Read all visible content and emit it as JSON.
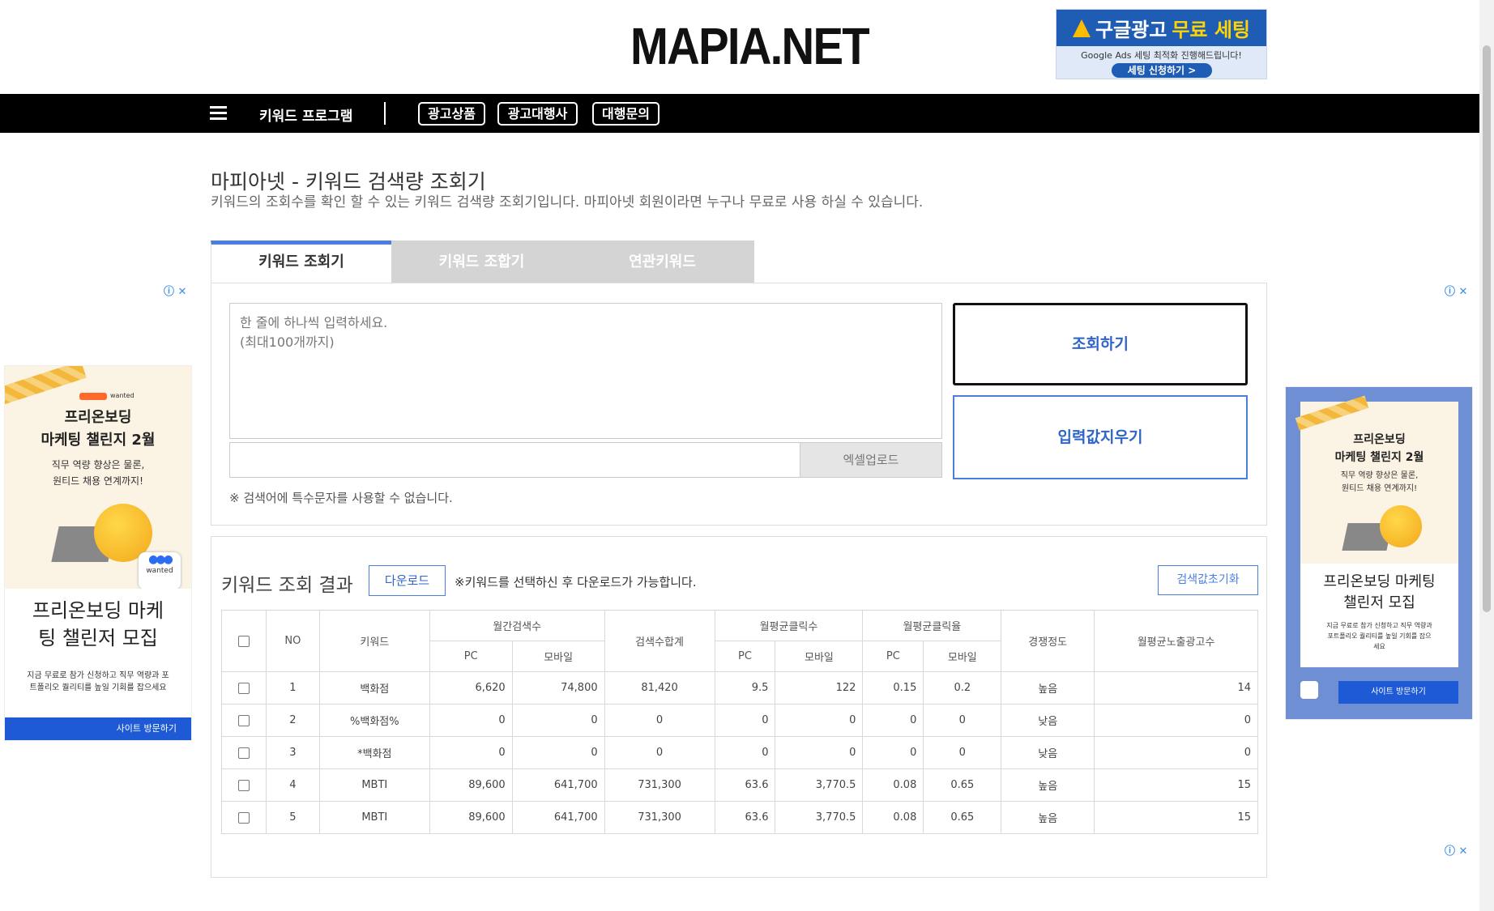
{
  "header": {
    "logo": "MAPIA.NET",
    "top_ad": {
      "headline_a": "구글광고",
      "headline_b": "무료 세팅",
      "subline": "Google Ads 세팅 최적화 진행해드립니다!",
      "cta": "세팅 신청하기 >"
    }
  },
  "nav": {
    "menu_title": "키워드 프로그램",
    "buttons": [
      "광고상품",
      "광고대행사",
      "대행문의"
    ]
  },
  "intro": {
    "title": "마피아넷 - 키워드 검색량 조회기",
    "description": "키워드의 조회수를 확인 할 수 있는 키워드 검색량 조회기입니다. 마피아넷 회원이라면 누구나 무료로 사용 하실 수 있습니다."
  },
  "tabs": [
    "키워드 조회기",
    "키워드 조합기",
    "연관키워드"
  ],
  "input_panel": {
    "textarea_placeholder": "한 줄에 하나씩 입력하세요.\n(최대100개까지)",
    "excel_upload": "엑셀업로드",
    "notice": "※ 검색어에 특수문자를 사용할 수 없습니다.",
    "search_button": "조회하기",
    "clear_button": "입력값지우기"
  },
  "results": {
    "title": "키워드 조회 결과",
    "download_button": "다운로드",
    "note": "※키워드를 선택하신 후 다운로드가 가능합니다.",
    "reset_button": "검색값초기화",
    "headers": {
      "no": "NO",
      "keyword": "키워드",
      "monthly_search": "월간검색수",
      "search_total": "검색수합계",
      "avg_clicks": "월평균클릭수",
      "avg_ctr": "월평균클릭율",
      "competition": "경쟁정도",
      "avg_impressions": "월평균노출광고수",
      "pc": "PC",
      "mobile": "모바일"
    },
    "rows": [
      {
        "no": "1",
        "keyword": "백화점",
        "pc": "6,620",
        "mobile": "74,800",
        "total": "81,420",
        "click_pc": "9.5",
        "click_mobile": "122",
        "ctr_pc": "0.15",
        "ctr_mobile": "0.2",
        "competition": "높음",
        "impressions": "14"
      },
      {
        "no": "2",
        "keyword": "%백화점%",
        "pc": "0",
        "mobile": "0",
        "total": "0",
        "click_pc": "0",
        "click_mobile": "0",
        "ctr_pc": "0",
        "ctr_mobile": "0",
        "competition": "낮음",
        "impressions": "0"
      },
      {
        "no": "3",
        "keyword": "*백화점",
        "pc": "0",
        "mobile": "0",
        "total": "0",
        "click_pc": "0",
        "click_mobile": "0",
        "ctr_pc": "0",
        "ctr_mobile": "0",
        "competition": "낮음",
        "impressions": "0"
      },
      {
        "no": "4",
        "keyword": "MBTI",
        "pc": "89,600",
        "mobile": "641,700",
        "total": "731,300",
        "click_pc": "63.6",
        "click_mobile": "3,770.5",
        "ctr_pc": "0.08",
        "ctr_mobile": "0.65",
        "competition": "높음",
        "impressions": "15"
      },
      {
        "no": "5",
        "keyword": "MBTI",
        "pc": "89,600",
        "mobile": "641,700",
        "total": "731,300",
        "click_pc": "63.6",
        "click_mobile": "3,770.5",
        "ctr_pc": "0.08",
        "ctr_mobile": "0.65",
        "competition": "높음",
        "impressions": "15"
      }
    ]
  },
  "side_ads": {
    "left": {
      "brand": "wanted",
      "title": "프리온보딩\n마케팅 챌린지 2월",
      "sub": "직무 역량 향상은 물론,\n원티드 채용 연계까지!",
      "headline": "프리온보딩 마케\n팅 챌린저 모집",
      "body": "지금 무료로 참가 신청하고 직무 역량과 포\n트폴리오 퀄리티를 높일 기회를 잡으세요",
      "cta": "사이트 방문하기"
    },
    "right": {
      "title": "프리온보딩\n마케팅 챌린지 2월",
      "sub": "직무 역량 향상은 물론,\n원티드 채용 연계까지!",
      "headline": "프리온보딩 마케팅\n챌린저 모집",
      "body": "지금 무료로 참가 신청하고 직무 역량과\n포트폴리오 퀄리티를 높일 기회를 잡으\n세요",
      "cta": "사이트 방문하기"
    },
    "close_marks": "ⓘ ✕"
  },
  "colors": {
    "accent": "#4a7fe0",
    "nav_bg": "#000000",
    "ad_blue": "#1f5ad6"
  }
}
